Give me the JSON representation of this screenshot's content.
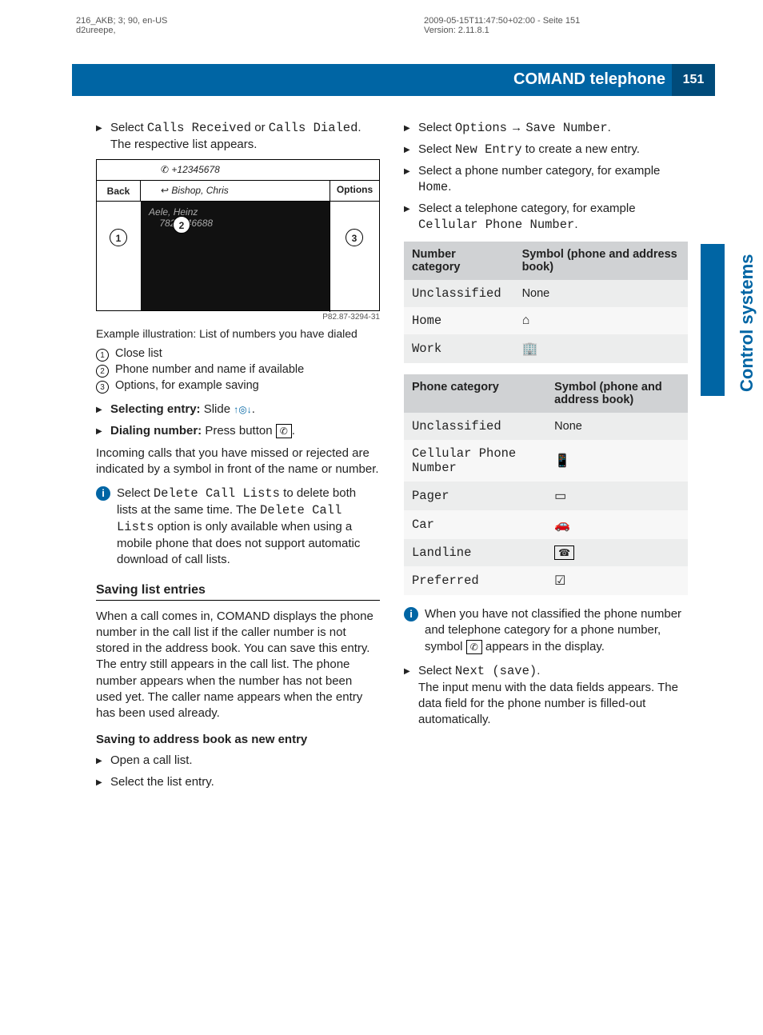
{
  "meta": {
    "topLeft": "216_AKB; 3; 90, en-US\nd2ureepe,",
    "topRight": "2009-05-15T11:47:50+02:00 - Seite 151\nVersion: 2.11.8.1"
  },
  "header": {
    "title": "COMAND telephone",
    "pageNo": "151",
    "sideTab": "Control systems"
  },
  "left": {
    "step1a": "Select ",
    "step1b": "Calls Received",
    "step1c": " or ",
    "step1d": "Calls Dialed",
    "step1e": ".",
    "step1f": "The respective list appears.",
    "illus": {
      "number": "+12345678",
      "bishop": "Bishop, Chris",
      "heinz": "ele, Heinz",
      "long": "7822446688",
      "back": "Back",
      "options": "Options",
      "id": "P82.87-3294-31"
    },
    "caption": "Example illustration: List of numbers you have dialed",
    "co1": "Close list",
    "co2": "Phone number and name if available",
    "co3": "Options, for example saving",
    "sel_label": "Selecting entry:",
    "sel_text": " Slide ",
    "dial_label": "Dialing number:",
    "dial_text": " Press button ",
    "missed": "Incoming calls that you have missed or rejected are indicated by a symbol in front of the name or number.",
    "info1a": "Select ",
    "info1b": "Delete Call Lists",
    "info1c": " to delete both lists at the same time. The ",
    "info1d": "Delete Call Lists",
    "info1e": " option is only available when using a mobile phone that does not support automatic download of call lists.",
    "h3": "Saving list entries",
    "savePara": "When a call comes in, COMAND displays the phone number in the call list if the caller number is not stored in the address book. You can save this entry. The entry still appears in the call list. The phone number appears when the number has not been used yet. The caller name appears when the entry has been used already.",
    "h4": "Saving to address book as new entry",
    "s1": "Open a call list.",
    "s2": "Select the list entry."
  },
  "right": {
    "r1a": "Select ",
    "r1b": "Options",
    "r1arrow": " → ",
    "r1c": "Save Number",
    "r1d": ".",
    "r2a": "Select ",
    "r2b": "New Entry",
    "r2c": " to create a new entry.",
    "r3a": "Select a phone number category, for example ",
    "r3b": "Home",
    "r3c": ".",
    "r4a": "Select a telephone category, for example ",
    "r4b": "Cellular Phone Number",
    "r4c": ".",
    "table1": {
      "h1": "Number category",
      "h2": "Symbol (phone and address book)",
      "rows": [
        {
          "cat": "Unclassified",
          "sym": "None",
          "symType": "text"
        },
        {
          "cat": "Home",
          "sym": "⌂",
          "symType": "icon"
        },
        {
          "cat": "Work",
          "sym": "🏢",
          "symType": "icon"
        }
      ]
    },
    "table2": {
      "h1": "Phone category",
      "h2": "Symbol (phone and address book)",
      "rows": [
        {
          "cat": "Unclassified",
          "sym": "None",
          "symType": "text"
        },
        {
          "cat": "Cellular Phone Number",
          "sym": "📱",
          "symType": "icon"
        },
        {
          "cat": "Pager",
          "sym": "▭",
          "symType": "icon"
        },
        {
          "cat": "Car",
          "sym": "🚗",
          "symType": "icon"
        },
        {
          "cat": "Landline",
          "sym": "☎",
          "symType": "boxicon"
        },
        {
          "cat": "Preferred",
          "sym": "☑",
          "symType": "icon"
        }
      ]
    },
    "info2a": "When you have not classified the phone number and telephone category for a phone number, symbol ",
    "info2b": " appears in the display.",
    "r5a": "Select ",
    "r5b": "Next (save)",
    "r5c": ".",
    "r5d": "The input menu with the data fields appears. The data field for the phone number is filled-out automatically."
  }
}
